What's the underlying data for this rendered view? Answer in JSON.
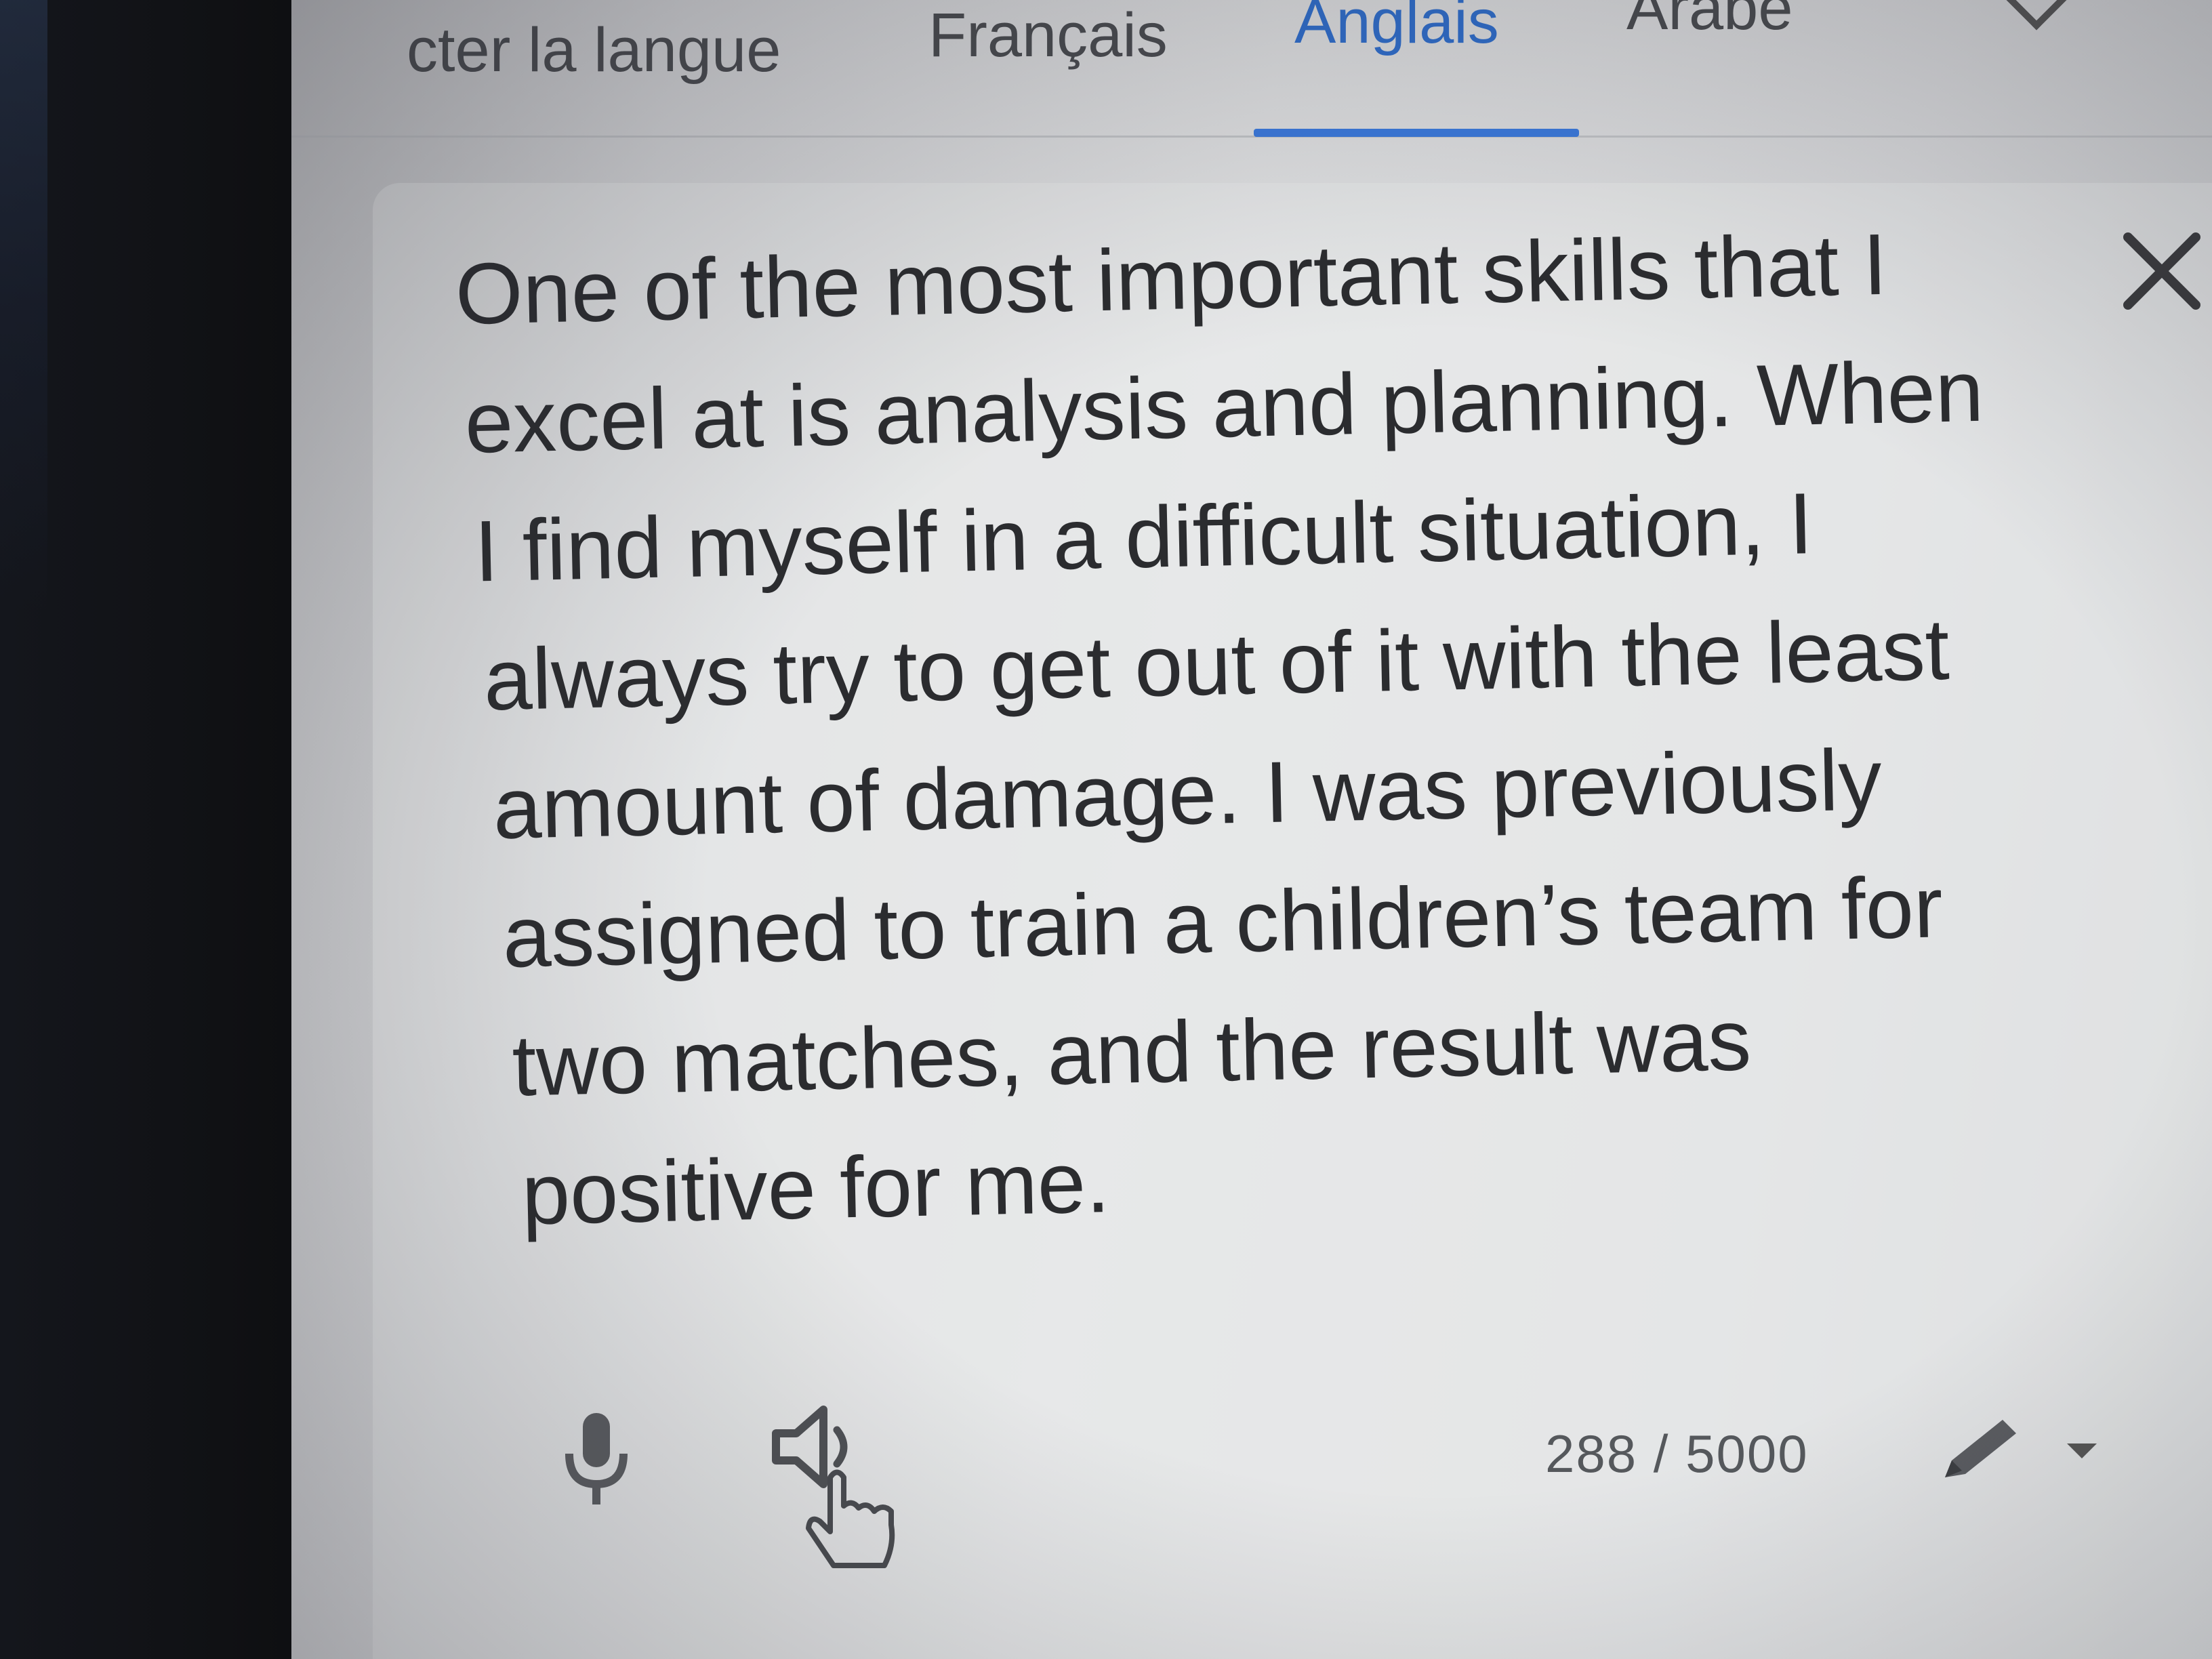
{
  "language_tabs": [
    {
      "label": "cter la langue"
    },
    {
      "label": "Français"
    },
    {
      "label": "Anglais"
    },
    {
      "label": "Arabe"
    }
  ],
  "active_tab": "Anglais",
  "source_text": {
    "lines": [
      "One of the most important skills that I",
      "excel at is analysis and planning. When",
      "I find myself in a difficult situation, I",
      "always try to get out of it with the least",
      "amount of damage. I was previously",
      "assigned to train a children’s team for",
      "two matches, and the result was",
      "positive for me."
    ]
  },
  "toolbar": {
    "char_count": "288 / 5000",
    "icons": [
      "microphone-icon",
      "speaker-icon",
      "pointer-hand-icon",
      "pencil-icon",
      "caret-down-icon"
    ]
  },
  "colors": {
    "accent": "#3b7be0",
    "text": "#2b2c2f"
  }
}
